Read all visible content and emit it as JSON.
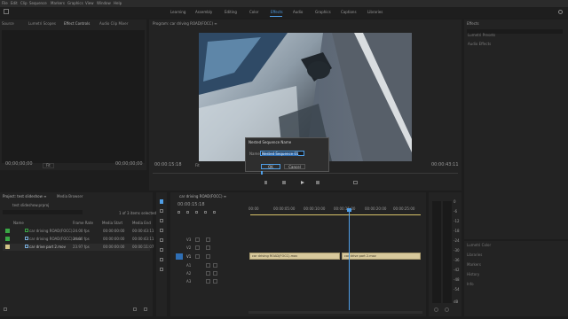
{
  "menu": [
    "File",
    "Edit",
    "Clip",
    "Sequence",
    "Markers",
    "Graphics",
    "View",
    "Window",
    "Help"
  ],
  "workspaces": [
    "Learning",
    "Assembly",
    "Editing",
    "Color",
    "Effects",
    "Audio",
    "Graphics",
    "Captions",
    "Libraries"
  ],
  "active_workspace": "Effects",
  "source_monitor": {
    "tabs": [
      "Source",
      "Lumetri Scopes",
      "Effect Controls",
      "Audio Clip Mixer"
    ],
    "timecode_left": "00;00;00;00",
    "fit": "Fit",
    "timecode_right": "00;00;00;00"
  },
  "program_monitor": {
    "title": "Program: car driving ROAD(FOCC) ≡",
    "timecode_left": "00:00:15:18",
    "timecode_right": "00:00:43:11",
    "fit": "Fit"
  },
  "dialog": {
    "title": "Nested Sequence Name",
    "name_label": "Name:",
    "name_value": "Nested Sequence 01",
    "ok": "OK",
    "cancel": "Cancel"
  },
  "project": {
    "tabs": [
      "Project: test slideshow ≡",
      "Media Browser"
    ],
    "file_name": "test slideshow.prproj",
    "selection_info": "1 of 3 items selected",
    "columns": [
      "Name",
      "Frame Rate",
      "Media Start",
      "Media End"
    ],
    "rows": [
      {
        "color": "#3aa845",
        "name": "car driving ROAD(FOCC)",
        "rate": "24.00 fps",
        "start": "00:00:00:00",
        "end": "00:00:43:11"
      },
      {
        "color": "#3aa845",
        "name": "car driving ROAD(FOCC).mov",
        "rate": "24.00 fps",
        "start": "00:00:00:00",
        "end": "00:00:43:11"
      },
      {
        "color": "#d3c487",
        "name": "car drive part 2.mov",
        "rate": "23.97 fps",
        "start": "00:00:00:00",
        "end": "00:00:11:07"
      }
    ]
  },
  "timeline": {
    "tab": "car driving ROAD(FOCC) ≡",
    "timecode": "00:00:15:18",
    "ruler": [
      "00:00",
      "00:00:05:00",
      "00:00:10:00",
      "00:00:15:00",
      "00:00:20:00",
      "00:00:25:00"
    ],
    "tracks": [
      "V3",
      "V2",
      "V1",
      "A1",
      "A2",
      "A3"
    ],
    "clips": [
      {
        "label": "car driving ROAD(FOCC).mov"
      },
      {
        "label": "car drive part 2.mov"
      }
    ]
  },
  "meter_scale": [
    "0",
    "-6",
    "-12",
    "-18",
    "-24",
    "-30",
    "-36",
    "-42",
    "-48",
    "-54",
    "dB"
  ],
  "right_panel": {
    "title": "Effects",
    "items": [
      "Lumetri Presets",
      "Audio Effects",
      "Audio Transitions",
      "Video Effects",
      "Video Transitions"
    ],
    "lower": [
      "Essential Graphics",
      "Essential Sound",
      "Lumetri Color",
      "Libraries",
      "Markers",
      "History",
      "Info"
    ]
  }
}
